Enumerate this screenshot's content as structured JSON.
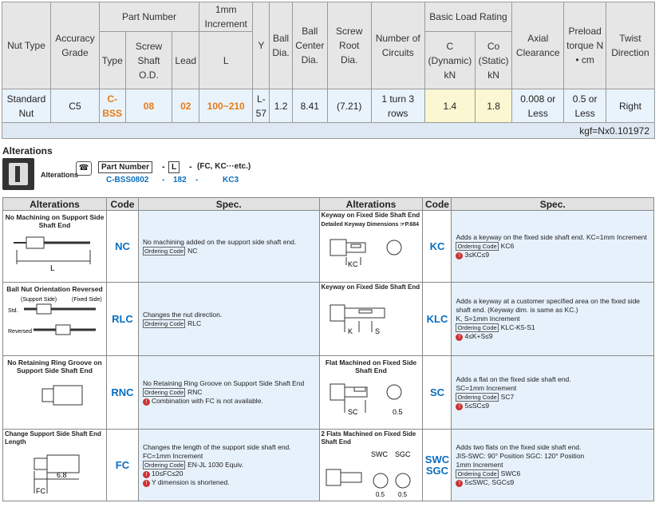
{
  "spec_table": {
    "headers": {
      "nut_type": "Nut Type",
      "accuracy_grade": "Accuracy Grade",
      "part_number": "Part Number",
      "type": "Type",
      "screw_shaft_od": "Screw Shaft O.D.",
      "lead": "Lead",
      "increment": "1mm Increment",
      "l": "L",
      "y": "Y",
      "ball_dia": "Ball Dia.",
      "ball_center_dia": "Ball Center Dia.",
      "screw_root_dia": "Screw Root Dia.",
      "number_of_circuits": "Number of Circuits",
      "basic_load_rating": "Basic Load Rating",
      "c_dynamic": "C (Dynamic) kN",
      "co_static": "Co (Static) kN",
      "axial_clearance": "Axial Clearance",
      "preload_torque": "Preload torque N • cm",
      "twist_direction": "Twist Direction"
    },
    "row": {
      "nut_type": "Standard Nut",
      "accuracy_grade": "C5",
      "type": "C-BSS",
      "screw_shaft_od": "08",
      "lead": "02",
      "l": "100~210",
      "y": "L-57",
      "ball_dia": "1.2",
      "ball_center_dia": "8.41",
      "screw_root_dia": "(7.21)",
      "number_of_circuits": "1 turn 3 rows",
      "c_dynamic": "1.4",
      "co_static": "1.8",
      "axial_clearance": "0.008 or Less",
      "preload_torque": "0.5 or Less",
      "twist_direction": "Right"
    },
    "note": "kgf=Nx0.101972"
  },
  "alterations": {
    "heading": "Alterations",
    "format": {
      "label": "Alterations",
      "part_number": "Part Number",
      "l": "L",
      "codes": "(FC, KC···etc.)",
      "example_part": "C-BSS0802",
      "example_l": "182",
      "example_code": "KC3"
    },
    "col_alterations": "Alterations",
    "col_code": "Code",
    "col_spec": "Spec.",
    "left": [
      {
        "title": "No Machining on Support Side Shaft End",
        "code": "NC",
        "spec": "No machining added on the support side shaft end.",
        "ordering": "NC",
        "cond": ""
      },
      {
        "title": "Ball Nut Orientation Reversed",
        "code": "RLC",
        "spec": "Changes the nut direction.",
        "ordering": "RLC",
        "cond": ""
      },
      {
        "title": "No Retaining Ring Groove on Support Side Shaft End",
        "code": "RNC",
        "spec": "No Retaining Ring Groove on Support Side Shaft End",
        "ordering": "RNC",
        "cond": "Combination with FC is not available."
      },
      {
        "title": "Change Support Side Shaft End Length",
        "code": "FC",
        "spec": "Changes the length of the support side shaft end. FC=1mm Increment",
        "ordering": "EN-JL 1030 Equiv.",
        "cond": "10≤FC≤20",
        "cond2": "Y dimension is shortened."
      }
    ],
    "right": [
      {
        "title": "Keyway on Fixed Side Shaft End",
        "subtitle": "Detailed Keyway Dimensions ☞P.684",
        "code": "KC",
        "spec": "Adds a keyway on the fixed side shaft end. KC=1mm Increment",
        "ordering": "KC6",
        "cond": "3≤KC≤9"
      },
      {
        "title": "Keyway on Fixed Side Shaft End",
        "code": "KLC",
        "spec": "Adds a keyway at a customer specified area on the fixed side shaft end. (Keyway dim. is same as KC.)",
        "spec2": "K, S=1mm Increment",
        "ordering": "KLC-K5-S1",
        "cond": "4≤K+S≤9"
      },
      {
        "title": "Flat Machined on Fixed Side Shaft End",
        "code": "SC",
        "spec": "Adds a flat on the fixed side shaft end.",
        "spec2": "SC=1mm Increment",
        "ordering": "SC7",
        "cond": "5≤SC≤9"
      },
      {
        "title": "2 Flats Machined on Fixed Side Shaft End",
        "code": "SWC",
        "code2": "SGC",
        "spec": "Adds two flats on the fixed side shaft end.",
        "spec2": "JIS-SWC: 90° Position  SGC: 120° Position",
        "spec3": "1mm Increment",
        "ordering": "SWC6",
        "cond": "5≤SWC, SGC≤9"
      }
    ],
    "ordering_label": "Ordering Code",
    "diagram_labels": {
      "l": "L",
      "support_side": "(Support Side)",
      "fixed_side": "(Fixed Side)",
      "std": "Std.",
      "reversed": "Reversed",
      "dim_68": "6.8",
      "fc": "FC",
      "kc": "KC",
      "k": "K",
      "s": "S",
      "sc": "SC",
      "dim_05": "0.5",
      "swc": "SWC",
      "sgc": "SGC"
    }
  },
  "colors": {
    "accent_orange": "#e87a14",
    "code_blue": "#0a6ec0",
    "row_blue": "#e9f3fb",
    "load_yellow": "#fbf7d2"
  }
}
